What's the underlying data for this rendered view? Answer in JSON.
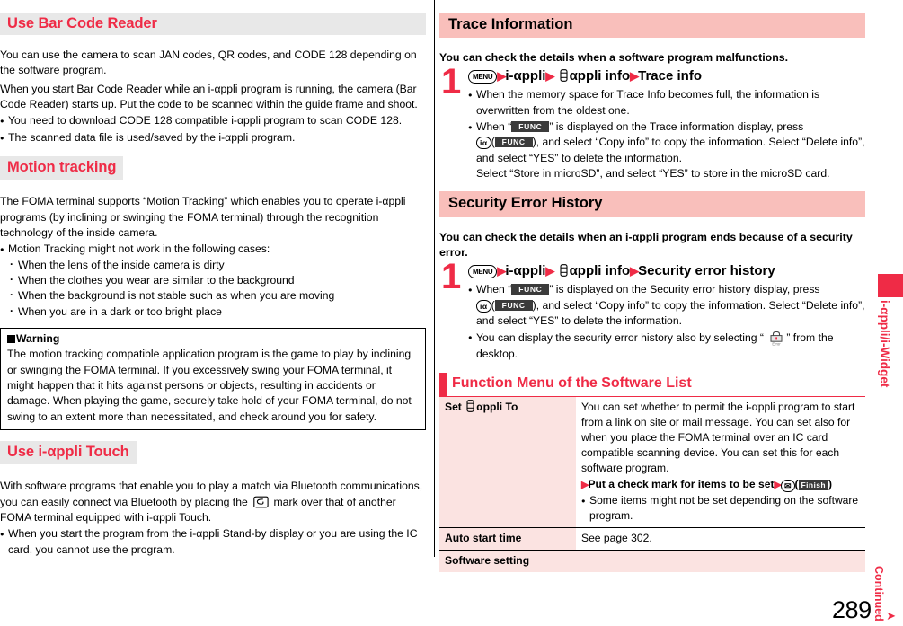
{
  "left_column": {
    "section1": {
      "heading": "Use Bar Code Reader",
      "para1": "You can use the camera to scan JAN codes, QR codes, and CODE 128 depending on the software program.",
      "para2": "When you start Bar Code Reader while an i-αppli program is running, the camera (Bar Code Reader) starts up. Put the code to be scanned within the guide frame and shoot.",
      "bullets": [
        "You need to download CODE 128 compatible i-αppli program to scan CODE 128.",
        "The scanned data file is used/saved by the i-αppli program."
      ]
    },
    "section2": {
      "heading": "Motion tracking",
      "para1": "The FOMA terminal supports “Motion Tracking” which enables you to operate i-αppli programs (by inclining or swinging the FOMA terminal) through the recognition technology of the inside camera.",
      "bullet_lead": "Motion Tracking might not work in the following cases:",
      "sub_bullets": [
        "When the lens of the inside camera is dirty",
        "When the clothes you wear are similar to the background",
        "When the background is not stable such as when you are moving",
        "When you are in a dark or too bright place"
      ],
      "warning": {
        "title": "Warning",
        "text": "The motion tracking compatible application program is the game to play by inclining or swinging the FOMA terminal. If you excessively swing your FOMA terminal, it might happen that it hits against persons or objects, resulting in accidents or damage. When playing the game, securely take hold of your FOMA terminal, do not swing to an extent more than necessitated, and check around you for safety."
      }
    },
    "section3": {
      "heading": "Use i-αppli Touch",
      "para_part1": "With software programs that enable you to play a match via Bluetooth communications, you can easily connect via Bluetooth by placing the",
      "para_part2": "mark over that of another FOMA terminal equipped with i-αppli Touch.",
      "bullets": [
        "When you start the program from the i-αppli Stand-by display or you are using the IC card, you cannot use the program."
      ]
    }
  },
  "right_column": {
    "section1": {
      "heading": "Trace Information",
      "intro": "You can check the details when a software program malfunctions.",
      "step_number": "1",
      "step_key_menu": "MENU",
      "step_text_1": "i-αppli",
      "step_text_2": "αppli info",
      "step_text_3": "Trace info",
      "bullet1": "When the memory space for Trace Info becomes full, the information is overwritten from the oldest one.",
      "bullet2_a": "When “",
      "bullet2_badge": "FUNC",
      "bullet2_b": "” is displayed on the Trace information display, press",
      "bullet2_key": "iα",
      "bullet2_c": "), and select “Copy info” to copy the information. Select “Delete info”, and select “YES” to delete the information.",
      "bullet2_d": "Select “Store in microSD”, and select “YES” to store in the microSD card."
    },
    "section2": {
      "heading": "Security Error History",
      "intro": "You can check the details when an i-αppli program ends because of a security error.",
      "step_number": "1",
      "step_key_menu": "MENU",
      "step_text_1": "i-αppli",
      "step_text_2": "αppli info",
      "step_text_3": "Security error history",
      "bullet1_a": "When “",
      "bullet1_badge": "FUNC",
      "bullet1_b": "” is displayed on the Security error history display, press",
      "bullet1_key": "iα",
      "bullet1_c": "), and select “Copy info” to copy the information. Select “Delete info”, and select “YES” to delete the information.",
      "bullet2_a": "You can display the security error history also by selecting “",
      "bullet2_icon_label": "Error",
      "bullet2_b": "” from the desktop."
    },
    "section3": {
      "heading": "Function Menu of the Software List",
      "rows": [
        {
          "key_pre": "Set",
          "key_post": "αppli To",
          "value_para": "You can set whether to permit the i-αppli program to start from a link on site or mail message. You can set also for when you place the FOMA terminal over an IC card compatible scanning device. You can set this for each software program.",
          "value_action": "Put a check mark for items to be set",
          "value_action_badge": "Finish",
          "value_bullet": "Some items might not be set depending on the software program."
        },
        {
          "key_pre": "Auto start time",
          "key_post": "",
          "value_para": "See page 302."
        },
        {
          "key_pre": "Software setting",
          "key_post": "",
          "value_para": ""
        }
      ]
    }
  },
  "side_tab": {
    "label": "i-αppli/i-Widget"
  },
  "footer": {
    "page_number": "289",
    "continued_label": "Continued"
  },
  "colors": {
    "accent_red": "#ef2b46",
    "heading_pink_bg": "#f9bfbb",
    "heading_gray_bg": "#e8e8e8",
    "table_key_bg": "#fbe3e1"
  }
}
